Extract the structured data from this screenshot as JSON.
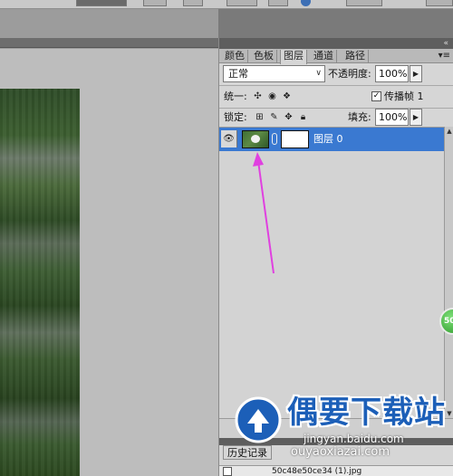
{
  "panel_tabs": {
    "color": "颜色",
    "swatches": "色板",
    "layers": "图层",
    "channels": "通道",
    "paths": "路径"
  },
  "blend": {
    "mode": "正常",
    "opacity_label": "不透明度:",
    "opacity_value": "100%"
  },
  "unify": {
    "label": "统一:",
    "propagate_label": "传播帧 1",
    "propagate_checked": true
  },
  "lock": {
    "label": "锁定:",
    "fill_label": "填充:",
    "fill_value": "100%"
  },
  "layer": {
    "name": "图层 0",
    "selected": true
  },
  "history": {
    "tab_label": "历史记录",
    "item_name": "50c48e50ce34 (1).jpg"
  },
  "watermark": {
    "title": "偶要下载站",
    "subtitle_1": "jingyan.baidu.com",
    "subtitle_2": "ouyaoxiazai.com"
  },
  "badge": {
    "text": "50"
  },
  "colors": {
    "selection": "#3a79d1",
    "annotation_arrow": "#e040e0",
    "watermark_blue": "#1c5fb8"
  }
}
